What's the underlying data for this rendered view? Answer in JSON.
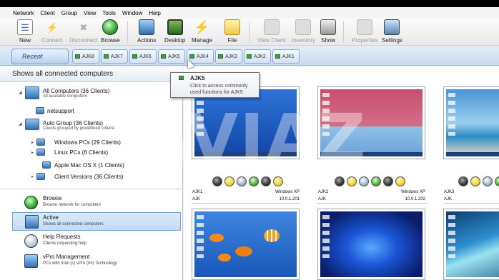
{
  "menu": [
    "Network",
    "Client",
    "Group",
    "View",
    "Tools",
    "Window",
    "Help"
  ],
  "toolbar": {
    "new": "New",
    "connect": "Connect",
    "disconnect": "Disconnect",
    "browse": "Browse",
    "actions": "Actions",
    "desktop": "Desktop",
    "manage": "Manage",
    "file": "File",
    "view_client": "View Client",
    "inventory": "Inventory",
    "show": "Show",
    "properties": "Properties",
    "settings": "Settings"
  },
  "tabs": {
    "recent": "Recent",
    "clients": [
      "AJK8",
      "AJK7",
      "AJK6",
      "AJK5",
      "AJK4",
      "AJK3",
      "AJK2",
      "AJK1"
    ]
  },
  "tooltip": {
    "title": "AJK5",
    "desc": "Click to access commonly used functions for AJK5"
  },
  "sidebar": {
    "header": "Shows all connected computers",
    "tree": {
      "all_computers": "All Computers (36 Clients)",
      "all_computers_sub": "All available computers",
      "netsupport": "netsupport",
      "auto_group": "Auto Group (36 Clients)",
      "auto_group_sub": "Clients grouped by predefined criteria",
      "windows": "Windows PCs (29 Clients)",
      "linux": "Linux PCs (6 Clients)",
      "mac": "Apple Mac OS X (1 Clients)",
      "versions": "Client Versions (36 Clients)"
    },
    "nav": {
      "browse": "Browse",
      "browse_sub": "Browse network for computers",
      "active": "Active",
      "active_sub": "Shows all connected computers",
      "help": "Help Requests",
      "help_sub": "Clients requesting help",
      "vpro": "vPro Management",
      "vpro_sub": "PCs with Intel (c) vPro (tm) Technology"
    }
  },
  "clients": [
    {
      "name": "AJK1",
      "os": "Windows XP",
      "user": "AJK",
      "ip": "10.0.1.201"
    },
    {
      "name": "AJK2",
      "os": "Windows XP",
      "user": "AJK",
      "ip": "10.0.1.202"
    },
    {
      "name": "AJK3",
      "user": "AJK"
    }
  ],
  "watermark": "AVIAZ"
}
